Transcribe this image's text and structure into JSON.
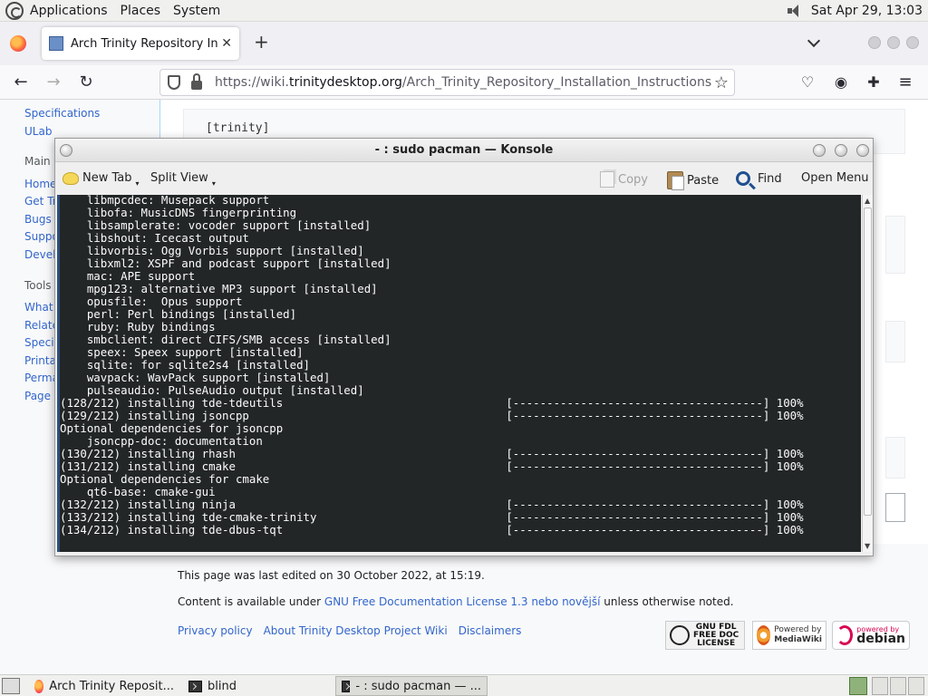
{
  "top_panel": {
    "menus": [
      "Applications",
      "Places",
      "System"
    ],
    "clock": "Sat Apr 29, 13:03"
  },
  "browser": {
    "tab_title": "Arch Trinity Repository Installation Instructions",
    "url_prefix": "https://wiki.",
    "url_domain": "trinitydesktop.org",
    "url_path": "/Arch_Trinity_Repository_Installation_Instructions"
  },
  "wiki": {
    "sidebar": {
      "links_top": [
        "Specifications",
        "ULab"
      ],
      "main_heading": "Main S",
      "main_links": [
        "Home",
        "Get Tr",
        "Bugs",
        "Suppo",
        "Develo"
      ],
      "tools_heading": "Tools",
      "tools_links": [
        "What",
        "Relate",
        "Specia",
        "Printa",
        "Perma",
        "Page"
      ]
    },
    "pre_text": "[trinity]",
    "last_edited": "This page was last edited on 30 October 2022, at 15:19.",
    "license_before": "Content is available under ",
    "license_link": "GNU Free Documentation License 1.3 nebo novější",
    "license_after": " unless otherwise noted.",
    "footer_links": [
      "Privacy policy",
      "About Trinity Desktop Project Wiki",
      "Disclaimers"
    ],
    "badges": {
      "fdl_lines": [
        "GNU FDL",
        "FREE DOC",
        "LICENSE"
      ],
      "mediawiki_lines": [
        "Powered by",
        "MediaWiki"
      ],
      "debian_small": "powered by",
      "debian_big": "debian"
    }
  },
  "konsole": {
    "title": "- : sudo pacman — Konsole",
    "toolbar": {
      "new_tab": "New Tab",
      "split_view": "Split View",
      "copy": "Copy",
      "paste": "Paste",
      "find": "Find",
      "open_menu": "Open Menu"
    },
    "terminal_lines": [
      "    libmpcdec: Musepack support",
      "    libofa: MusicDNS fingerprinting",
      "    libsamplerate: vocoder support [installed]",
      "    libshout: Icecast output",
      "    libvorbis: Ogg Vorbis support [installed]",
      "    libxml2: XSPF and podcast support [installed]",
      "    mac: APE support",
      "    mpg123: alternative MP3 support [installed]",
      "    opusfile:  Opus support",
      "    perl: Perl bindings [installed]",
      "    ruby: Ruby bindings",
      "    smbclient: direct CIFS/SMB access [installed]",
      "    speex: Speex support [installed]",
      "    sqlite: for sqlite2s4 [installed]",
      "    wavpack: WavPack support [installed]",
      "    pulseaudio: PulseAudio output [installed]",
      "(128/212) installing tde-tdeutils                                 [-------------------------------------] 100%",
      "(129/212) installing jsoncpp                                      [-------------------------------------] 100%",
      "Optional dependencies for jsoncpp",
      "    jsoncpp-doc: documentation",
      "(130/212) installing rhash                                        [-------------------------------------] 100%",
      "(131/212) installing cmake                                        [-------------------------------------] 100%",
      "Optional dependencies for cmake",
      "    qt6-base: cmake-gui",
      "(132/212) installing ninja                                        [-------------------------------------] 100%",
      "(133/212) installing tde-cmake-trinity                            [-------------------------------------] 100%",
      "(134/212) installing tde-dbus-tqt                                 [-------------------------------------] 100%"
    ]
  },
  "taskbar": {
    "tasks": [
      "Arch Trinity Reposit...",
      "blind",
      "- : sudo pacman — ..."
    ]
  }
}
